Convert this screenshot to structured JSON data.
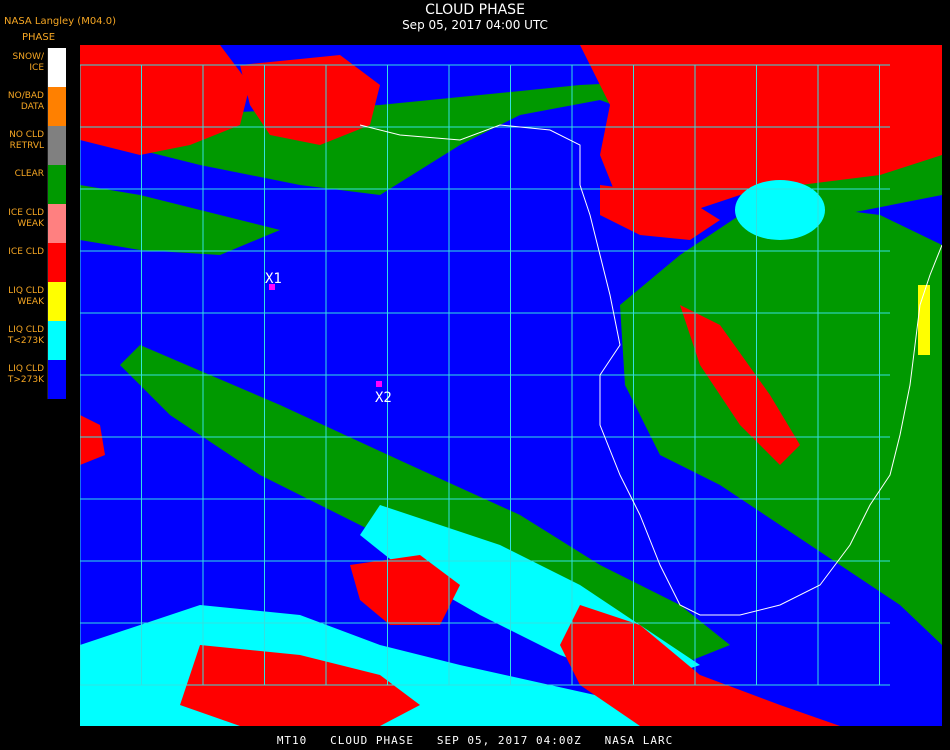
{
  "header": {
    "title": "CLOUD PHASE",
    "datetime": "Sep 05, 2017 04:00 UTC",
    "org": "NASA Langley (M04.0)",
    "legend_title": "PHASE"
  },
  "legend": [
    {
      "label": "SNOW/\nICE",
      "color": "#ffffff"
    },
    {
      "label": "NO/BAD\nDATA",
      "color": "#ff8000"
    },
    {
      "label": "NO CLD\nRETRVL",
      "color": "#808080"
    },
    {
      "label": "CLEAR",
      "color": "#009900"
    },
    {
      "label": "ICE CLD\nWEAK",
      "color": "#ff8080"
    },
    {
      "label": "ICE CLD",
      "color": "#ff0000"
    },
    {
      "label": "LIQ CLD\nWEAK",
      "color": "#ffff00"
    },
    {
      "label": "LIQ CLD\nT<273K",
      "color": "#00ffff"
    },
    {
      "label": "LIQ CLD\nT>273K",
      "color": "#0000ff"
    }
  ],
  "markers": [
    {
      "label": "X1"
    },
    {
      "label": "X2"
    }
  ],
  "footer": "MT10   CLOUD PHASE   SEP 05, 2017 04:00Z   NASA LARC",
  "colors": {
    "liquid_warm": "#0000ff",
    "liquid_cold": "#00ffff",
    "ice": "#ff0000",
    "clear": "#009900",
    "grid": "#33e0e0",
    "coast": "#ffffff",
    "marker": "#ff00ff"
  }
}
